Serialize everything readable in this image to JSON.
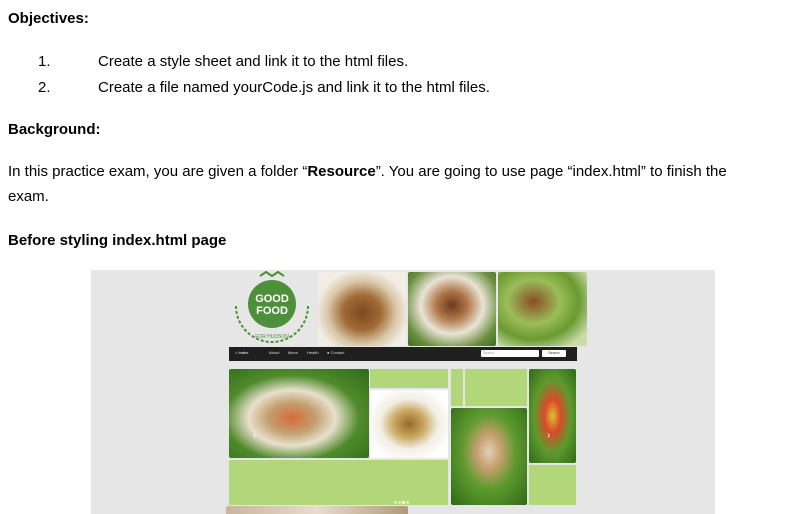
{
  "objectives": {
    "heading": "Objectives:",
    "items": [
      {
        "num": "1.",
        "text": "Create a style sheet and link it to the html files."
      },
      {
        "num": "2.",
        "text": "Create a file named yourCode.js and link it to the html files."
      }
    ]
  },
  "background": {
    "heading": "Background:",
    "text_before": "In this practice exam, you are given a folder “",
    "resource": "Resource",
    "text_after": "”. You are going to use page “index.html”  to finish the exam."
  },
  "before_heading": "Before styling index.html page",
  "screenshot": {
    "logo": {
      "line1": "GOOD",
      "line2": "FOOD",
      "sub": "FOR HUDSON"
    },
    "nav": [
      {
        "label": "Index",
        "icon": "home-icon"
      },
      {
        "label": "About"
      },
      {
        "label": "Menu"
      },
      {
        "label": "Health"
      },
      {
        "label": "Contact",
        "icon": "contact-icon"
      }
    ],
    "search_placeholder": "Search",
    "search_button": "Search",
    "colors": {
      "green_tile": "#b2d77a",
      "logo_green": "#4d8f3a",
      "navbar": "#1f1f1f"
    }
  }
}
